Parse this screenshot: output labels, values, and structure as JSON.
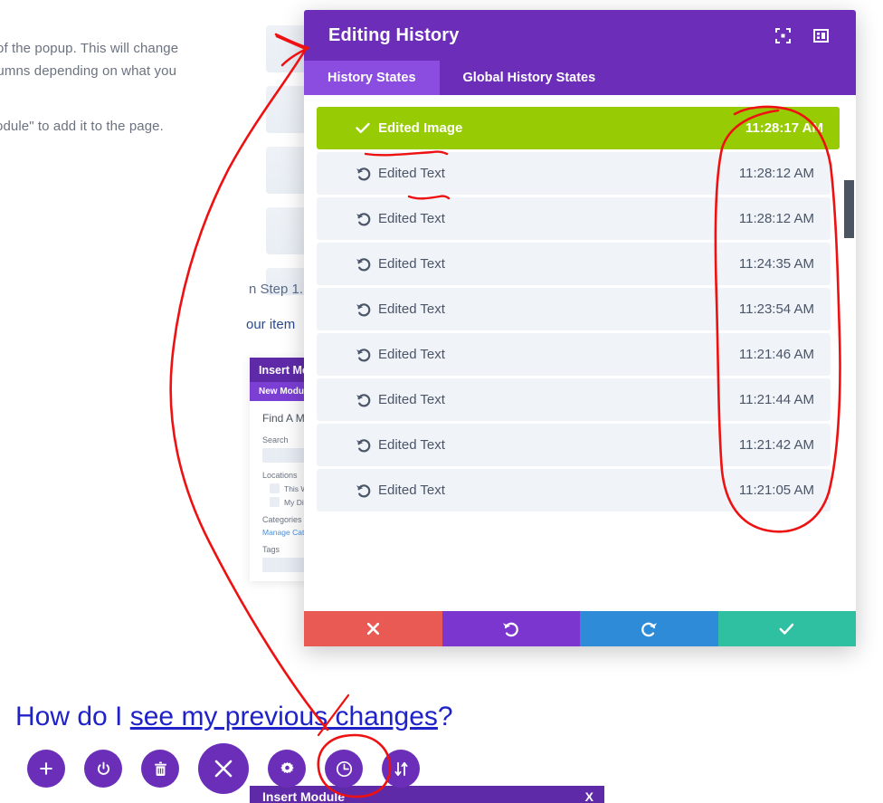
{
  "background": {
    "paragraph_lines": [
      "of the popup. This will change",
      "lumns depending on what you"
    ],
    "paragraph_line_3": "odule\" to add it to the page.",
    "mid_text_1": "n Step 1.",
    "mid_text_2": "our item"
  },
  "insert_panel": {
    "title": "Insert Modu",
    "subtitle": "New Module",
    "find_heading": "Find A Modu",
    "search_label": "Search",
    "locations_label": "Locations",
    "location_options": [
      "This Websi",
      "My Divi Clo"
    ],
    "categories_label": "Categories",
    "manage_categories_link": "Manage Categor",
    "tags_label": "Tags"
  },
  "bottom_strip": {
    "title": "Insert Module",
    "close_label": "X"
  },
  "modal": {
    "title": "Editing History",
    "header_icons": [
      {
        "name": "focus-target-icon",
        "label": "Focus"
      },
      {
        "name": "layout-panel-icon",
        "label": "Layout"
      }
    ],
    "tabs": [
      {
        "label": "History States",
        "active": true
      },
      {
        "label": "Global History States",
        "active": false
      }
    ],
    "states": [
      {
        "label": "Edited Image",
        "time": "11:28:17 AM",
        "active": true,
        "icon": "check-icon"
      },
      {
        "label": "Edited Text",
        "time": "11:28:12 AM",
        "active": false,
        "icon": "undo-icon"
      },
      {
        "label": "Edited Text",
        "time": "11:28:12 AM",
        "active": false,
        "icon": "undo-icon"
      },
      {
        "label": "Edited Text",
        "time": "11:24:35 AM",
        "active": false,
        "icon": "undo-icon"
      },
      {
        "label": "Edited Text",
        "time": "11:23:54 AM",
        "active": false,
        "icon": "undo-icon"
      },
      {
        "label": "Edited Text",
        "time": "11:21:46 AM",
        "active": false,
        "icon": "undo-icon"
      },
      {
        "label": "Edited Text",
        "time": "11:21:44 AM",
        "active": false,
        "icon": "undo-icon"
      },
      {
        "label": "Edited Text",
        "time": "11:21:42 AM",
        "active": false,
        "icon": "undo-icon"
      },
      {
        "label": "Edited Text",
        "time": "11:21:05 AM",
        "active": false,
        "icon": "undo-icon"
      }
    ],
    "footer_buttons": [
      {
        "name": "cancel-button",
        "icon": "close-icon",
        "color": "#ea5a55"
      },
      {
        "name": "undo-button",
        "icon": "undo-icon",
        "color": "#7b36cf"
      },
      {
        "name": "redo-button",
        "icon": "redo-icon",
        "color": "#2e8bd8"
      },
      {
        "name": "accept-button",
        "icon": "check-icon",
        "color": "#2fc0a2"
      }
    ]
  },
  "question": {
    "prefix": "How do I ",
    "link": "see my previous changes",
    "suffix": "?"
  },
  "toolbar": {
    "buttons": [
      {
        "name": "add-button",
        "icon": "plus-icon",
        "size": "small"
      },
      {
        "name": "power-button",
        "icon": "power-icon",
        "size": "small"
      },
      {
        "name": "trash-button",
        "icon": "trash-icon",
        "size": "small"
      },
      {
        "name": "close-button",
        "icon": "close-icon",
        "size": "big"
      },
      {
        "name": "settings-button",
        "icon": "gear-icon",
        "size": "small"
      },
      {
        "name": "history-button",
        "icon": "clock-icon",
        "size": "small"
      },
      {
        "name": "reorder-button",
        "icon": "arrows-updown-icon",
        "size": "small"
      }
    ]
  },
  "colors": {
    "modal_header_purple": "#6c2eb9",
    "active_tab_purple": "#8a4de0",
    "active_state_green": "#97cc04",
    "row_grey": "#f0f3f8",
    "cancel_red": "#ea5a55",
    "undo_purple": "#7b36cf",
    "redo_blue": "#2e8bd8",
    "accept_teal": "#2fc0a2",
    "toolbar_purple": "#6b2eb8",
    "heading_blue": "#1f22c9",
    "annotation_red": "#ee1111"
  }
}
